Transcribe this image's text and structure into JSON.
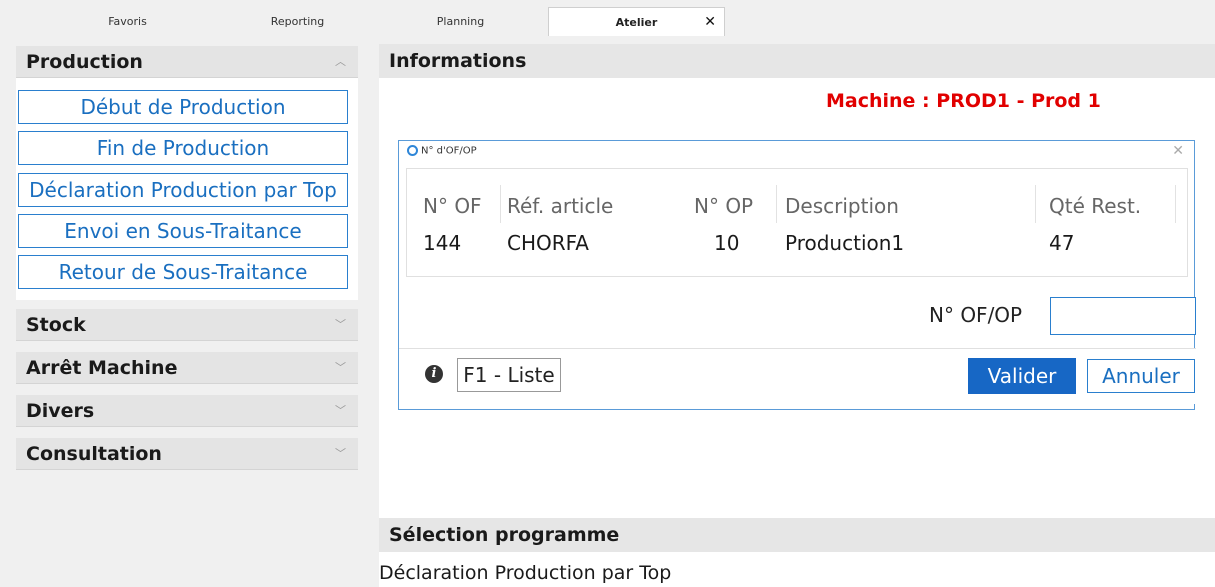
{
  "tabs": [
    {
      "label": "Favoris"
    },
    {
      "label": "Reporting"
    },
    {
      "label": "Planning"
    },
    {
      "label": "Atelier",
      "close": "✕"
    }
  ],
  "left": {
    "production": {
      "title": "Production",
      "items": [
        "Début de Production",
        "Fin de Production",
        "Déclaration Production par Top",
        "Envoi en Sous-Traitance",
        "Retour de Sous-Traitance"
      ]
    },
    "sections": [
      {
        "title": "Stock"
      },
      {
        "title": "Arrêt Machine"
      },
      {
        "title": "Divers"
      },
      {
        "title": "Consultation"
      }
    ]
  },
  "right": {
    "info_title": "Informations",
    "machine": "Machine : PROD1 - Prod 1",
    "dialog": {
      "title": "N° d'OF/OP",
      "close": "✕",
      "columns": [
        "N° OF",
        "Réf. article",
        "N° OP",
        "Description",
        "Qté Rest."
      ],
      "rows": [
        [
          "144",
          "CHORFA",
          "10",
          "Production1",
          "47"
        ]
      ],
      "input_label": "N° OF/OP",
      "input_value": "",
      "f1_label": "F1 - Liste",
      "valider_label": "Valider",
      "annuler_label": "Annuler"
    },
    "selection_title": "Sélection programme",
    "selection_value": "Déclaration Production par Top"
  },
  "colors": {
    "accent": "#1767c5",
    "machine_text": "#e10000",
    "button_border": "#2a7fce"
  },
  "icons": {
    "dialog_icon": "app-logo-icon",
    "info_icon": "info-icon",
    "chevron_up": "chevron-up-icon",
    "chevron_down": "chevron-down-icon"
  }
}
